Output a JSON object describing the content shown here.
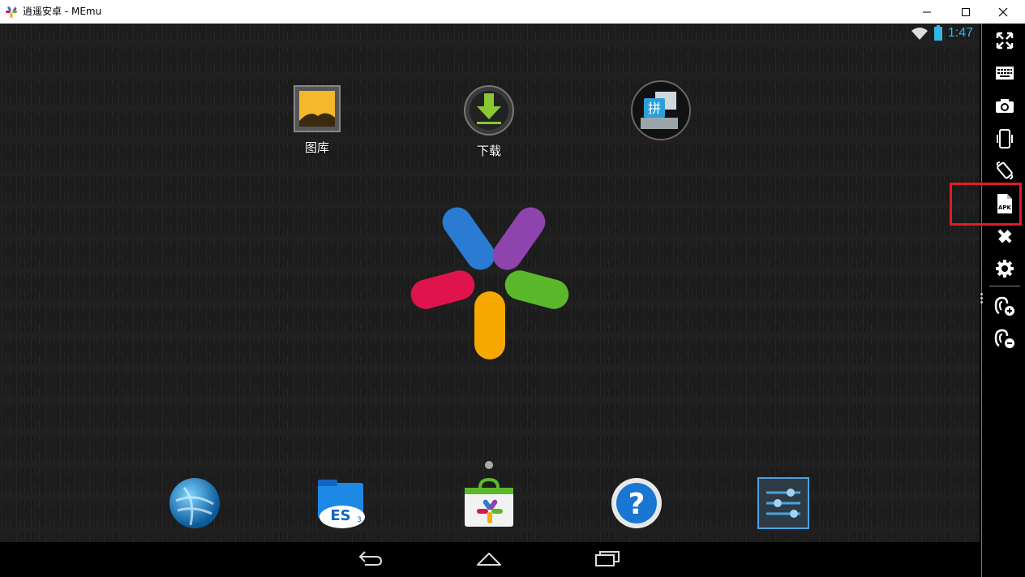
{
  "window": {
    "title": "逍遥安卓 - MEmu",
    "controls": [
      "minimize",
      "maximize",
      "close"
    ]
  },
  "status_bar": {
    "time": "1:47",
    "icons": [
      "wifi-icon",
      "battery-icon"
    ],
    "accent_color": "#33b5e5"
  },
  "home": {
    "apps": [
      {
        "label": "图库",
        "icon": "gallery-icon"
      },
      {
        "label": "下载",
        "icon": "download-icon"
      },
      {
        "label": "",
        "icon": "pinyin-input-icon"
      }
    ],
    "center_logo": "memu-logo"
  },
  "dock": {
    "items": [
      {
        "icon": "browser-globe-icon"
      },
      {
        "icon": "es-file-explorer-icon"
      },
      {
        "icon": "app-store-icon"
      },
      {
        "icon": "help-icon"
      },
      {
        "icon": "settings-sliders-icon"
      }
    ]
  },
  "navigation": {
    "buttons": [
      "back-icon",
      "home-icon",
      "recent-apps-icon"
    ]
  },
  "toolbar": {
    "tools": [
      {
        "name": "fullscreen-icon"
      },
      {
        "name": "keyboard-icon"
      },
      {
        "name": "camera-icon"
      },
      {
        "name": "shake-icon"
      },
      {
        "name": "rotate-icon"
      },
      {
        "name": "apk-install-icon",
        "label": "APK",
        "highlighted": true
      },
      {
        "name": "joystick-icon"
      },
      {
        "name": "gear-icon"
      },
      {
        "name": "volume-up-icon"
      },
      {
        "name": "volume-down-icon"
      }
    ],
    "highlight_color": "#e21c23"
  }
}
